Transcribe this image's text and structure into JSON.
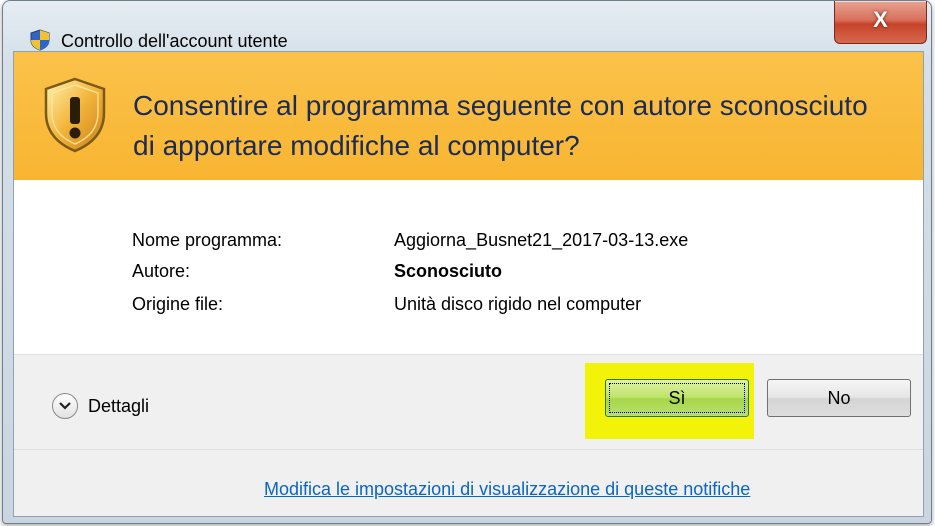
{
  "window": {
    "title": "Controllo dell'account utente",
    "close_glyph": "X"
  },
  "banner": {
    "headline": "Consentire al programma seguente con autore sconosciuto di apportare modifiche al computer?"
  },
  "details": [
    {
      "label": "Nome programma:",
      "value": "Aggiorna_Busnet21_2017-03-13.exe"
    },
    {
      "label": "Autore:",
      "value": "Sconosciuto"
    },
    {
      "label": "Origine file:",
      "value": "Unità disco rigido nel computer"
    }
  ],
  "footer": {
    "details_label": "Dettagli",
    "yes_label": "Sì",
    "no_label": "No",
    "settings_link": "Modifica le impostazioni di visualizzazione di queste notifiche"
  },
  "colors": {
    "banner": "#f8b531",
    "headline": "#1a2b55",
    "highlight": "#f3f30a",
    "link": "#0a66c2"
  }
}
